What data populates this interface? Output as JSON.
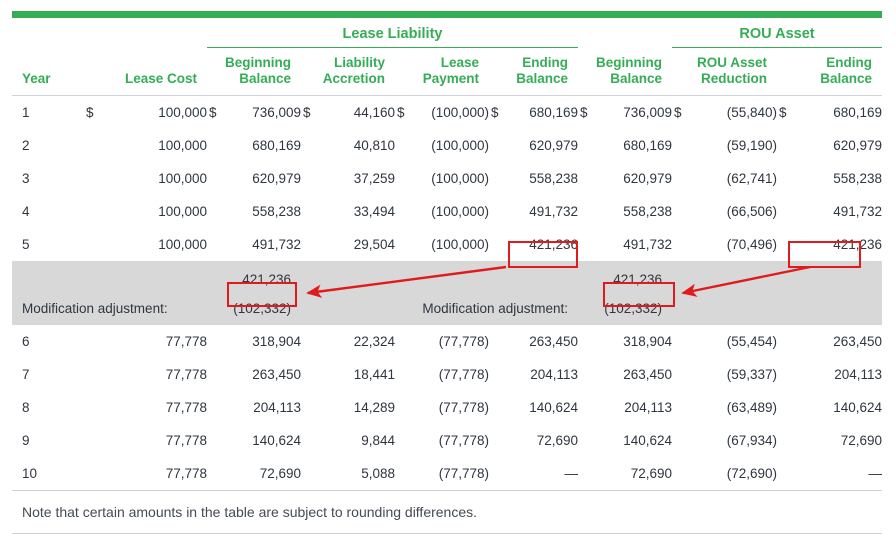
{
  "theme": {
    "accent_green": "#34ad55",
    "highlight_red": "#e01b1b",
    "band_gray": "#d8d8d8",
    "text": "#2f3640"
  },
  "header": {
    "groups": [
      {
        "label": "Lease Liability"
      },
      {
        "label": "ROU Asset"
      }
    ],
    "columns": [
      {
        "line1": "Year",
        "line2": ""
      },
      {
        "line1": "Lease Cost",
        "line2": ""
      },
      {
        "line1": "Beginning",
        "line2": "Balance"
      },
      {
        "line1": "Liability",
        "line2": "Accretion"
      },
      {
        "line1": "Lease",
        "line2": "Payment"
      },
      {
        "line1": "Ending",
        "line2": "Balance"
      },
      {
        "line1": "Beginning",
        "line2": "Balance"
      },
      {
        "line1": "ROU Asset",
        "line2": "Reduction"
      },
      {
        "line1": "Ending",
        "line2": "Balance"
      }
    ]
  },
  "rows": [
    {
      "year": "1",
      "lease_cost_cur": "$",
      "lease_cost": "100,000",
      "ll_begin_cur": "$",
      "ll_begin": "736,009",
      "ll_accretion_cur": "$",
      "ll_accretion": "44,160",
      "ll_payment_cur": "$",
      "ll_payment": "(100,000)",
      "ll_end_cur": "$",
      "ll_end": "680,169",
      "rou_begin_cur": "$",
      "rou_begin": "736,009",
      "rou_reduction_cur": "$",
      "rou_reduction": "(55,840)",
      "rou_end_cur": "$",
      "rou_end": "680,169"
    },
    {
      "year": "2",
      "lease_cost_cur": "",
      "lease_cost": "100,000",
      "ll_begin_cur": "",
      "ll_begin": "680,169",
      "ll_accretion_cur": "",
      "ll_accretion": "40,810",
      "ll_payment_cur": "",
      "ll_payment": "(100,000)",
      "ll_end_cur": "",
      "ll_end": "620,979",
      "rou_begin_cur": "",
      "rou_begin": "680,169",
      "rou_reduction_cur": "",
      "rou_reduction": "(59,190)",
      "rou_end_cur": "",
      "rou_end": "620,979"
    },
    {
      "year": "3",
      "lease_cost_cur": "",
      "lease_cost": "100,000",
      "ll_begin_cur": "",
      "ll_begin": "620,979",
      "ll_accretion_cur": "",
      "ll_accretion": "37,259",
      "ll_payment_cur": "",
      "ll_payment": "(100,000)",
      "ll_end_cur": "",
      "ll_end": "558,238",
      "rou_begin_cur": "",
      "rou_begin": "620,979",
      "rou_reduction_cur": "",
      "rou_reduction": "(62,741)",
      "rou_end_cur": "",
      "rou_end": "558,238"
    },
    {
      "year": "4",
      "lease_cost_cur": "",
      "lease_cost": "100,000",
      "ll_begin_cur": "",
      "ll_begin": "558,238",
      "ll_accretion_cur": "",
      "ll_accretion": "33,494",
      "ll_payment_cur": "",
      "ll_payment": "(100,000)",
      "ll_end_cur": "",
      "ll_end": "491,732",
      "rou_begin_cur": "",
      "rou_begin": "558,238",
      "rou_reduction_cur": "",
      "rou_reduction": "(66,506)",
      "rou_end_cur": "",
      "rou_end": "491,732"
    },
    {
      "year": "5",
      "lease_cost_cur": "",
      "lease_cost": "100,000",
      "ll_begin_cur": "",
      "ll_begin": "491,732",
      "ll_accretion_cur": "",
      "ll_accretion": "29,504",
      "ll_payment_cur": "",
      "ll_payment": "(100,000)",
      "ll_end_cur": "",
      "ll_end": "421,236",
      "rou_begin_cur": "",
      "rou_begin": "491,732",
      "rou_reduction_cur": "",
      "rou_reduction": "(70,496)",
      "rou_end_cur": "",
      "rou_end": "421,236"
    },
    {
      "year": "6",
      "lease_cost_cur": "",
      "lease_cost": "77,778",
      "ll_begin_cur": "",
      "ll_begin": "318,904",
      "ll_accretion_cur": "",
      "ll_accretion": "22,324",
      "ll_payment_cur": "",
      "ll_payment": "(77,778)",
      "ll_end_cur": "",
      "ll_end": "263,450",
      "rou_begin_cur": "",
      "rou_begin": "318,904",
      "rou_reduction_cur": "",
      "rou_reduction": "(55,454)",
      "rou_end_cur": "",
      "rou_end": "263,450"
    },
    {
      "year": "7",
      "lease_cost_cur": "",
      "lease_cost": "77,778",
      "ll_begin_cur": "",
      "ll_begin": "263,450",
      "ll_accretion_cur": "",
      "ll_accretion": "18,441",
      "ll_payment_cur": "",
      "ll_payment": "(77,778)",
      "ll_end_cur": "",
      "ll_end": "204,113",
      "rou_begin_cur": "",
      "rou_begin": "263,450",
      "rou_reduction_cur": "",
      "rou_reduction": "(59,337)",
      "rou_end_cur": "",
      "rou_end": "204,113"
    },
    {
      "year": "8",
      "lease_cost_cur": "",
      "lease_cost": "77,778",
      "ll_begin_cur": "",
      "ll_begin": "204,113",
      "ll_accretion_cur": "",
      "ll_accretion": "14,289",
      "ll_payment_cur": "",
      "ll_payment": "(77,778)",
      "ll_end_cur": "",
      "ll_end": "140,624",
      "rou_begin_cur": "",
      "rou_begin": "204,113",
      "rou_reduction_cur": "",
      "rou_reduction": "(63,489)",
      "rou_end_cur": "",
      "rou_end": "140,624"
    },
    {
      "year": "9",
      "lease_cost_cur": "",
      "lease_cost": "77,778",
      "ll_begin_cur": "",
      "ll_begin": "140,624",
      "ll_accretion_cur": "",
      "ll_accretion": "9,844",
      "ll_payment_cur": "",
      "ll_payment": "(77,778)",
      "ll_end_cur": "",
      "ll_end": "72,690",
      "rou_begin_cur": "",
      "rou_begin": "140,624",
      "rou_reduction_cur": "",
      "rou_reduction": "(67,934)",
      "rou_end_cur": "",
      "rou_end": "72,690"
    },
    {
      "year": "10",
      "lease_cost_cur": "",
      "lease_cost": "77,778",
      "ll_begin_cur": "",
      "ll_begin": "72,690",
      "ll_accretion_cur": "",
      "ll_accretion": "5,088",
      "ll_payment_cur": "",
      "ll_payment": "(77,778)",
      "ll_end_cur": "",
      "ll_end": "—",
      "rou_begin_cur": "",
      "rou_begin": "72,690",
      "rou_reduction_cur": "",
      "rou_reduction": "(72,690)",
      "rou_end_cur": "",
      "rou_end": "—"
    }
  ],
  "modification": {
    "liability_label": "Modification adjustment:",
    "liability_carry": "421,236",
    "liability_adjust": "(102,332)",
    "rou_label": "Modification adjustment:",
    "rou_carry": "421,236",
    "rou_adjust": "(102,332)"
  },
  "footnote": {
    "text": "Note that certain amounts in the table are subject to rounding differences."
  },
  "annotations": {
    "boxes": [
      {
        "name": "ll-ending-year5",
        "value": "421,236"
      },
      {
        "name": "rou-ending-year5",
        "value": "421,236"
      },
      {
        "name": "ll-mod-carry",
        "value": "421,236"
      },
      {
        "name": "rou-mod-carry",
        "value": "421,236"
      }
    ]
  }
}
